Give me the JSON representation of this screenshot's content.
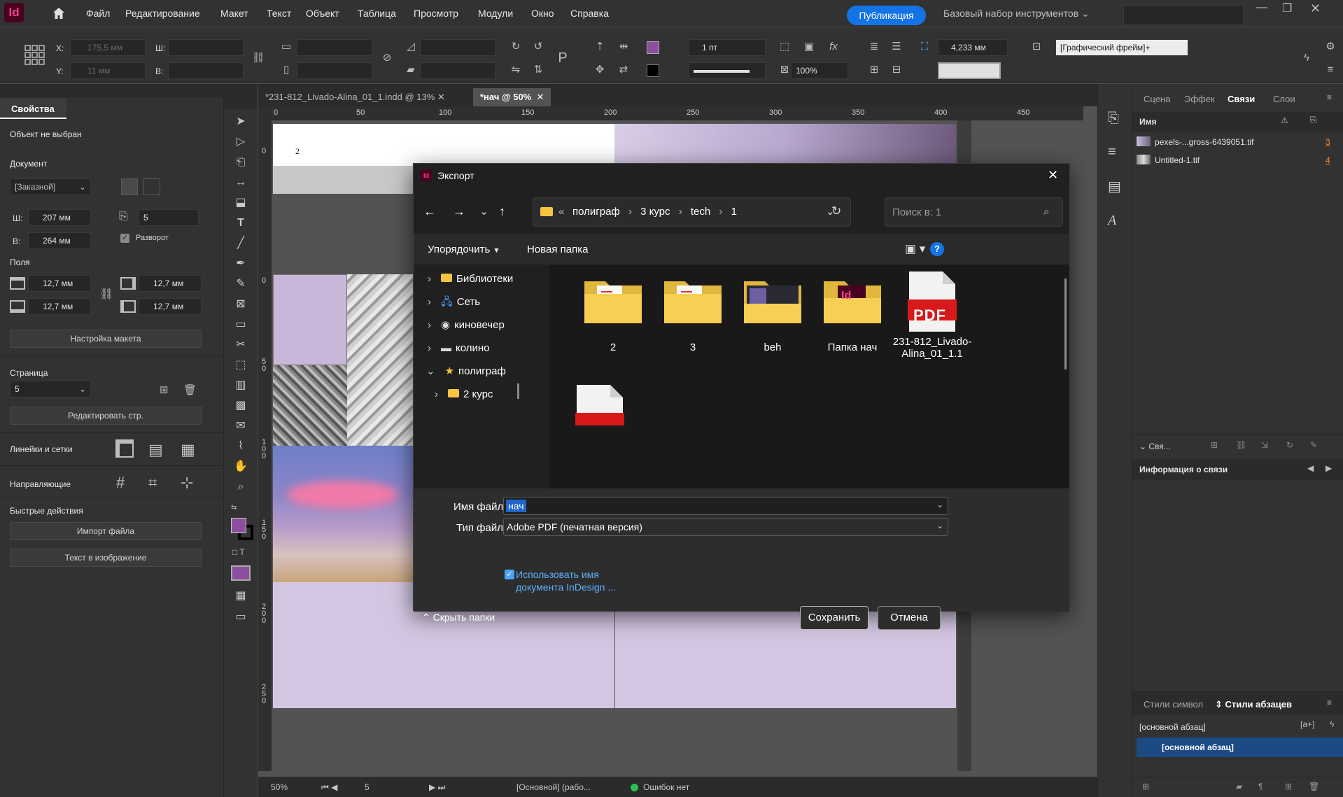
{
  "app": {
    "logo_text": "Id",
    "publish_label": "Публикация",
    "workspace": "Базовый набор инструментов"
  },
  "menu": [
    "Файл",
    "Редактирование",
    "Макет",
    "Текст",
    "Объект",
    "Таблица",
    "Просмотр",
    "Модули",
    "Окно",
    "Справка"
  ],
  "control": {
    "x_label": "X:",
    "x_value": "175,5 мм",
    "y_label": "Y:",
    "y_value": "11 мм",
    "w_label": "Ш:",
    "h_label": "В:",
    "stroke_weight": "1 пт",
    "opacity": "100%",
    "spacing_value": "4,233 мм",
    "frame_style": "[Графический фрейм]+"
  },
  "properties": {
    "tab": "Свойства",
    "no_selection": "Объект не выбран",
    "document_title": "Документ",
    "preset": "[Заказной]",
    "width_label": "Ш:",
    "width_value": "207 мм",
    "height_label": "В:",
    "height_value": "264 мм",
    "pages_value": "5",
    "facing_label": "Разворот",
    "margins_title": "Поля",
    "margin_top": "12,7 мм",
    "margin_bottom": "12,7 мм",
    "margin_left": "12,7 мм",
    "margin_right": "12,7 мм",
    "layout_button": "Настройка макета",
    "page_title": "Страница",
    "page_value": "5",
    "edit_page_button": "Редактировать стр.",
    "rulers_title": "Линейки и сетки",
    "guides_title": "Направляющие",
    "quick_title": "Быстрые действия",
    "import_button": "Импорт файла",
    "text_to_image_button": "Текст в изображение"
  },
  "tabs": [
    {
      "label": "*231-812_Livado-Alina_01_1.indd @ 13%",
      "active": false
    },
    {
      "label": "*нач @ 50%",
      "active": true
    }
  ],
  "ruler": {
    "h": [
      "0",
      "50",
      "100",
      "150",
      "200",
      "250",
      "300",
      "350",
      "400",
      "450"
    ],
    "v": [
      "0",
      "50",
      "100",
      "150",
      "200",
      "250"
    ]
  },
  "canvas": {
    "page_number": "2"
  },
  "status": {
    "zoom": "50%",
    "page": "5",
    "master": "[Основной] (рабо...",
    "errors": "Ошибок нет"
  },
  "right": {
    "tabs": [
      "Сцена",
      "Эффек",
      "Связи",
      "Слои"
    ],
    "name_header": "Имя",
    "links": [
      {
        "name": "pexels-...gross-6439051.tif",
        "page": "3"
      },
      {
        "name": "Untitled-1.tif",
        "page": "4"
      }
    ],
    "collapse_label": "Свя...",
    "link_info": "Информация о связи",
    "styles_tabs": [
      "Стили символ",
      "Стили абзацев"
    ],
    "style_current": "[основной абзац]",
    "style_selected": "[основной абзац]"
  },
  "dialog": {
    "title": "Экспорт",
    "breadcrumb": [
      "полиграф",
      "3 курс",
      "tech",
      "1"
    ],
    "search_placeholder": "Поиск в: 1",
    "organize": "Упорядочить",
    "new_folder": "Новая папка",
    "nav": [
      {
        "label": "Библиотеки",
        "icon": "folder"
      },
      {
        "label": "Сеть",
        "icon": "network"
      },
      {
        "label": "киновечер",
        "icon": "disc"
      },
      {
        "label": "колино",
        "icon": "drive"
      },
      {
        "label": "полиграф",
        "icon": "star"
      },
      {
        "label": "2 курс",
        "icon": "folder"
      }
    ],
    "files": [
      {
        "name": "2",
        "type": "folder-doc"
      },
      {
        "name": "3",
        "type": "folder-doc"
      },
      {
        "name": "beh",
        "type": "folder-screen"
      },
      {
        "name": "Папка нач",
        "type": "folder-id"
      },
      {
        "name": "231-812_Livado-Alina_01_1.1",
        "type": "pdf"
      }
    ],
    "filename_label": "Имя файла:",
    "filename_value": "нач",
    "filetype_label": "Тип файла:",
    "filetype_value": "Adobe PDF (печатная версия)",
    "use_docname": "Использовать имя документа InDesign ...",
    "hide_folders": "Скрыть папки",
    "save": "Сохранить",
    "cancel": "Отмена",
    "pdf_badge": "PDF",
    "id_badge": "Id"
  }
}
